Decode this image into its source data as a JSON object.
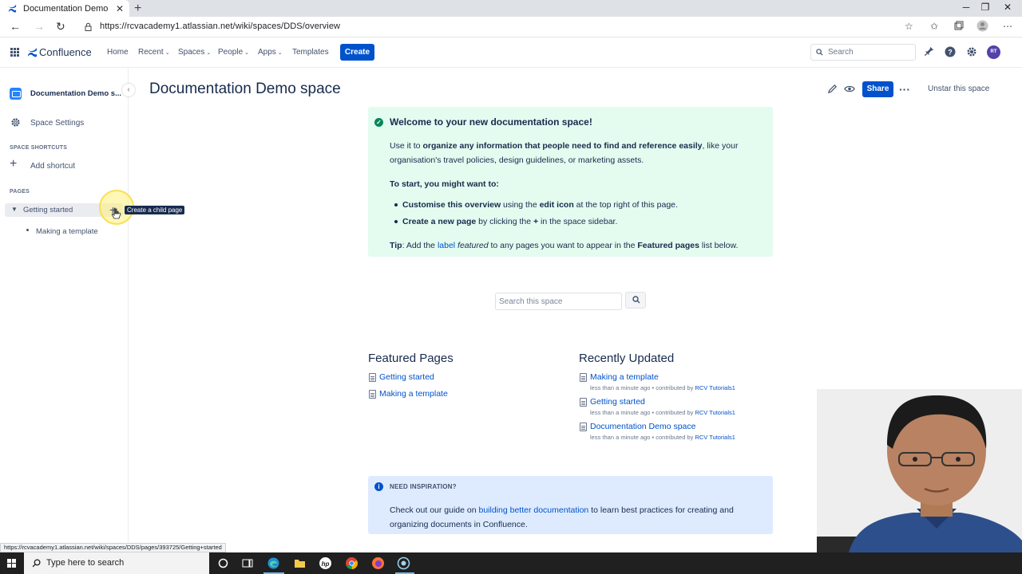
{
  "browser": {
    "tab_title": "Documentation Demo space - C",
    "tab_close": "✕",
    "new_tab": "+",
    "url": "https://rcvacademy1.atlassian.net/wiki/spaces/DDS/overview",
    "status_url": "https://rcvacademy1.atlassian.net/wiki/spaces/DDS/pages/393725/Getting+started"
  },
  "topnav": {
    "logo": "Confluence",
    "items": [
      {
        "label": "Home",
        "dropdown": false
      },
      {
        "label": "Recent",
        "dropdown": true
      },
      {
        "label": "Spaces",
        "dropdown": true
      },
      {
        "label": "People",
        "dropdown": true
      },
      {
        "label": "Apps",
        "dropdown": true
      },
      {
        "label": "Templates",
        "dropdown": false
      }
    ],
    "create_label": "Create",
    "search_placeholder": "Search",
    "avatar_initials": "RT"
  },
  "sidebar": {
    "space_name": "Documentation Demo s...",
    "space_settings": "Space Settings",
    "shortcuts_heading": "SPACE SHORTCUTS",
    "add_shortcut": "Add shortcut",
    "pages_heading": "PAGES",
    "tree": [
      {
        "label": "Getting started",
        "expanded": true
      },
      {
        "label": "Making a template",
        "child": true
      }
    ],
    "add_child_icon": "+",
    "tooltip": "Create a child page"
  },
  "page": {
    "title": "Documentation Demo space",
    "share_label": "Share",
    "unstar_label": "Unstar this space",
    "welcome": {
      "title": "Welcome to your new documentation space!",
      "p1_a": "Use it to ",
      "p1_b": "organize any information that people need to find and reference easily",
      "p1_c": ", like your",
      "p1_d": "organisation's travel policies, design guidelines, or marketing assets.",
      "start_heading": "To start, you might want to:",
      "b1_a": "Customise this overview",
      "b1_b": " using the ",
      "b1_c": "edit icon",
      "b1_d": " at the top right of this page.",
      "b2_a": "Create a new page",
      "b2_b": " by clicking the ",
      "b2_c": "+",
      "b2_d": " in the space sidebar.",
      "tip_a": "Tip",
      "tip_b": ": Add the ",
      "tip_c": "label",
      "tip_d": "featured",
      "tip_e": " to any pages you want to appear in the ",
      "tip_f": "Featured pages",
      "tip_g": " list below."
    },
    "space_search_placeholder": "Search this space",
    "featured": {
      "title": "Featured Pages",
      "items": [
        "Getting started",
        "Making a template"
      ]
    },
    "recent": {
      "title": "Recently Updated",
      "items": [
        {
          "title": "Making a template",
          "meta": "less than a minute ago • contributed by ",
          "who": "RCV Tutorials1"
        },
        {
          "title": "Getting started",
          "meta": "less than a minute ago • contributed by ",
          "who": "RCV Tutorials1"
        },
        {
          "title": "Documentation Demo space",
          "meta": "less than a minute ago • contributed by ",
          "who": "RCV Tutorials1"
        }
      ]
    },
    "inspiration": {
      "title": "NEED INSPIRATION?",
      "body_a": "Check out our guide on ",
      "body_link": "building better documentation",
      "body_b": " to learn best practices for creating and organizing documents in Confluence."
    }
  },
  "taskbar": {
    "search_placeholder": "Type here to search"
  },
  "colors": {
    "brand": "#0052cc",
    "success_bg": "#e3fcef",
    "info_bg": "#deebff"
  }
}
